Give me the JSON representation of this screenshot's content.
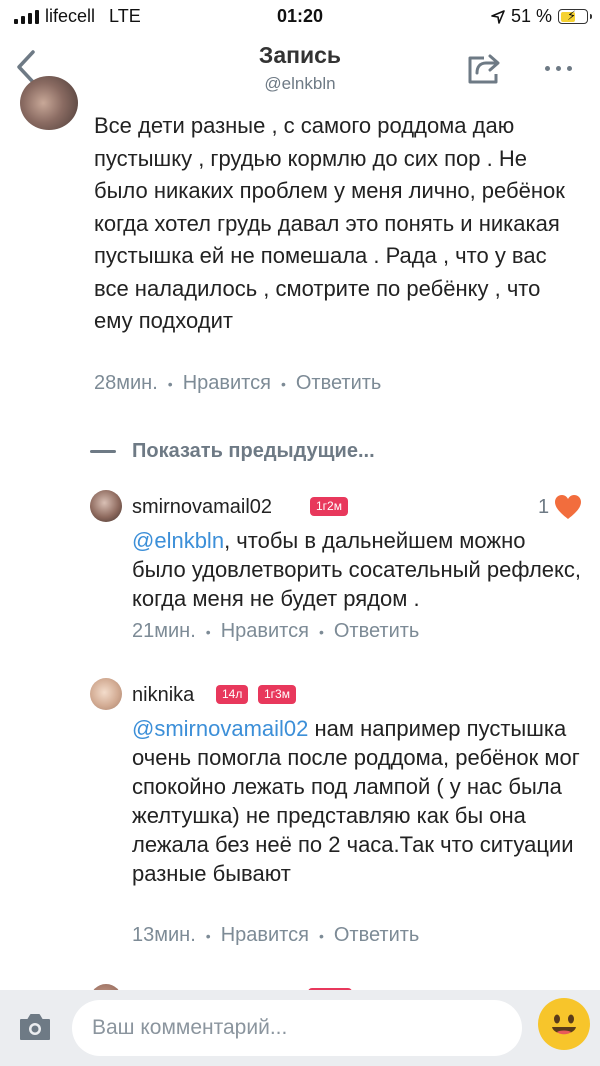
{
  "status_bar": {
    "carrier": "lifecell",
    "network": "LTE",
    "time": "01:20",
    "battery": "51 %"
  },
  "header": {
    "title": "Запись",
    "subtitle": "@elnkbln",
    "icons": {
      "back": "chevron-left-icon",
      "share": "share-icon",
      "more": "more-dots-icon"
    }
  },
  "top_comment": {
    "text": "Все дети разные , с самого роддома даю пустышку , грудью кормлю до сих пор . Не было никаких проблем у меня лично, ребёнок когда хотел грудь давал это понять и никакая пустышка ей не помешала . Рада , что у вас все наладилось , смотрите по ребёнку , что ему подходит",
    "time": "28мин.",
    "like_label": "Нравится",
    "reply_label": "Ответить"
  },
  "show_previous": "Показать предыдущие...",
  "replies": [
    {
      "author": "smirnovamail02",
      "badges": [
        "1г2м"
      ],
      "mention": "@elnkbln",
      "text": ", чтобы в дальнейшем можно было удовлетворить сосательный рефлекс, когда меня не будет рядом .",
      "time": "21мин.",
      "like_label": "Нравится",
      "reply_label": "Ответить",
      "likes": "1"
    },
    {
      "author": "niknika",
      "badges": [
        "14л",
        "1г3м"
      ],
      "mention": "@smirnovamail02",
      "text": " нам например пустышка очень помогла после роддома, ребёнок мог спокойно лежать под лампой ( у нас была желтушка) не представляю как бы она лежала без неё по 2 часа.Так что ситуации разные бывают",
      "time": "13мин.",
      "like_label": "Нравится",
      "reply_label": "Ответить"
    }
  ],
  "composer": {
    "placeholder": "Ваш комментарий...",
    "icons": {
      "camera": "camera-icon",
      "emoji": "emoji-icon"
    }
  },
  "colors": {
    "accent_link": "#3c8fd8",
    "badge": "#e8385c",
    "heart": "#f26d3d",
    "muted": "#7d8b96",
    "composer_bg": "#ebedf0"
  }
}
